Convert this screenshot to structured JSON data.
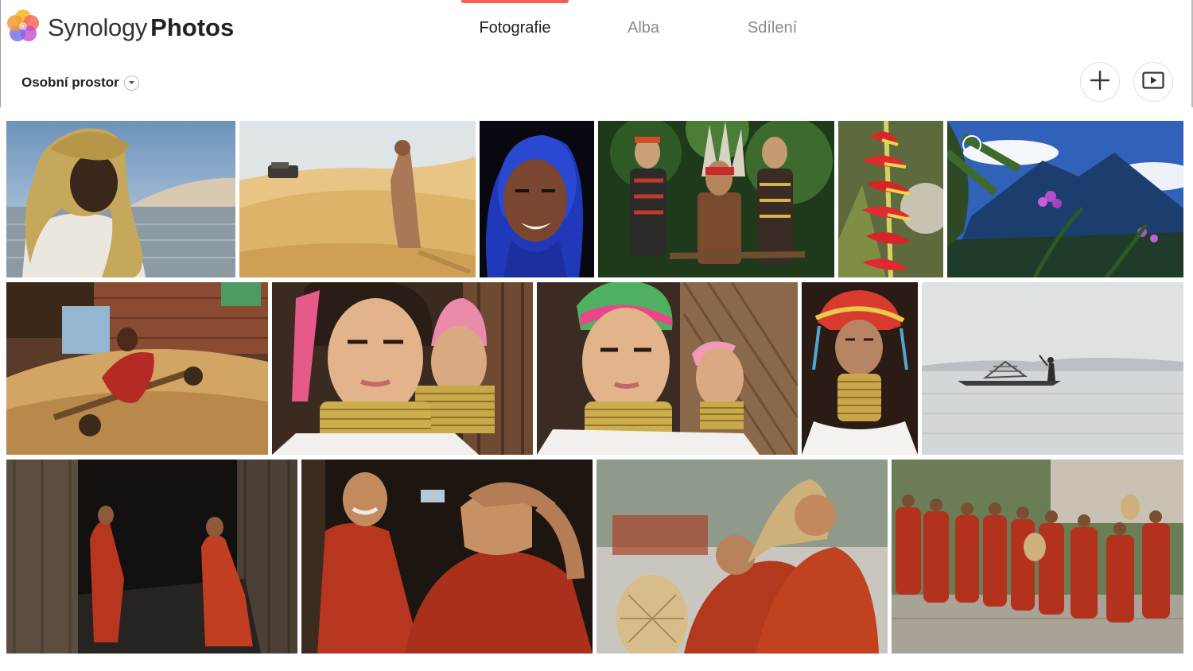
{
  "app": {
    "brand_light": "Synology",
    "brand_bold": "Photos",
    "logo_icon": "synology-photos-flower-logo"
  },
  "tabs": [
    {
      "label": "Fotografie",
      "active": true
    },
    {
      "label": "Alba",
      "active": false
    },
    {
      "label": "Sdílení",
      "active": false
    }
  ],
  "space_selector": {
    "label": "Osobní prostor",
    "icon": "chevron-down-icon"
  },
  "actions": {
    "add_icon": "plus-icon",
    "slideshow_icon": "slideshow-play-icon"
  },
  "colors": {
    "accent": "#f0614f",
    "tab_active": "#1e1e1e",
    "tab_inactive": "#8a8a8a"
  },
  "photos": [
    {
      "row": 1,
      "subject": "man in turban by lake"
    },
    {
      "row": 1,
      "subject": "desert dunes with car"
    },
    {
      "row": 1,
      "subject": "woman in blue hijab"
    },
    {
      "row": 1,
      "subject": "tribal dancers in forest"
    },
    {
      "row": 1,
      "subject": "red heliconia flower"
    },
    {
      "row": 1,
      "subject": "mountain with purple flowers"
    },
    {
      "row": 2,
      "subject": "child on wooden cart"
    },
    {
      "row": 2,
      "subject": "girls with neck rings"
    },
    {
      "row": 2,
      "subject": "girls with neck rings"
    },
    {
      "row": 2,
      "subject": "woman with neck rings"
    },
    {
      "row": 2,
      "subject": "fisherman on misty lake"
    },
    {
      "row": 3,
      "subject": "monks in dark doorway"
    },
    {
      "row": 3,
      "subject": "smiling monk"
    },
    {
      "row": 3,
      "subject": "monks with fans"
    },
    {
      "row": 3,
      "subject": "procession of monks"
    }
  ]
}
